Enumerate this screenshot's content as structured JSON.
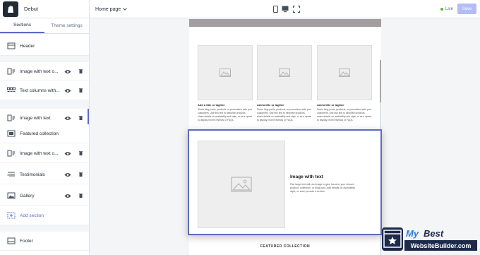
{
  "app": {
    "theme_name": "Debut"
  },
  "sidebar": {
    "tabs": [
      {
        "label": "Sections",
        "active": true
      },
      {
        "label": "Theme settings",
        "active": false
      }
    ],
    "header_label": "Header",
    "items": [
      {
        "label": "Image with text o...",
        "icon": "image-with-text-icon"
      },
      {
        "label": "Text columns with...",
        "icon": "text-columns-icon"
      },
      {
        "label": "Image with text",
        "icon": "image-with-text-icon",
        "selected": true
      },
      {
        "label": "Featured collection",
        "icon": "featured-collection-icon"
      },
      {
        "label": "Image with text o...",
        "icon": "image-with-text-icon"
      },
      {
        "label": "Testimonials",
        "icon": "testimonials-icon"
      },
      {
        "label": "Gallery",
        "icon": "gallery-icon"
      }
    ],
    "add_section_label": "Add section",
    "footer_label": "Footer"
  },
  "topbar": {
    "page_select": "Home page",
    "live_label": "Live",
    "save_label": "Save"
  },
  "preview": {
    "columns": [
      {
        "title": "Add a title or tagline",
        "text": "Share blog posts, products, or promotions with your customers. Use this text to describe products, share details on availability and style, or as a space to display recent reviews or FAQs."
      },
      {
        "title": "Add a title or tagline",
        "text": "Share blog posts, products, or promotions with your customers. Use this text to describe products, share details on availability and style, or as a space to display recent reviews or FAQs."
      },
      {
        "title": "Add a title or tagline",
        "text": "Share blog posts, products, or promotions with your customers. Use this text to describe products, share details on availability and style, or as a space to display recent reviews or FAQs."
      }
    ],
    "image_with_text": {
      "title": "Image with text",
      "text": "Pair large text with an image to give focus to your chosen product, collection, or blog post. Add details on availability, style, or even provide a review."
    },
    "featured_label": "FEATURED COLLECTION"
  },
  "watermark": {
    "line1_a": "My",
    "line1_b": "Best",
    "line2": "WebsiteBuilder.com"
  },
  "colors": {
    "accent": "#5c6ac4",
    "live": "#50b83c",
    "save_disabled": "#b3bcf5"
  }
}
